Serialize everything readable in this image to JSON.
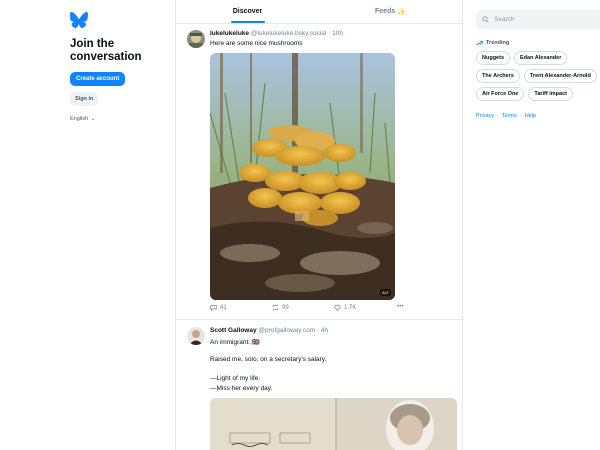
{
  "left": {
    "title": "Join the conversation",
    "create_account": "Create account",
    "sign_in": "Sign in",
    "language": "English"
  },
  "tabs": [
    {
      "label": "Discover",
      "active": true
    },
    {
      "label": "Feeds",
      "emoji": "✨",
      "active": false
    }
  ],
  "posts": [
    {
      "author": "lukelukeluke",
      "handle": "@lukelukeluke.bsky.social",
      "time": "10h",
      "text": "Here are some nice mushrooms",
      "media_alt_badge": "ALT",
      "replies": "41",
      "reposts": "99",
      "likes": "1.7K"
    },
    {
      "author": "Scott Galloway",
      "handle": "@profgalloway.com",
      "time": "4h",
      "lines": [
        "An immigrant. 🇬🇧",
        "Raised me, solo, on a secretary's salary.",
        "—Light of my life.",
        "—Miss her every day."
      ]
    }
  ],
  "right": {
    "search_placeholder": "Search",
    "trending_label": "Trending",
    "trending": [
      "Nuggets",
      "Edan Alexander",
      "The Archers",
      "Trent Alexander-Arnold",
      "Air Force One",
      "Tariff impact"
    ],
    "footer": [
      "Privacy",
      "Terms",
      "Help"
    ]
  },
  "colors": {
    "accent": "#1083fe",
    "border": "#e6ebf0",
    "muted": "#6f869f"
  }
}
